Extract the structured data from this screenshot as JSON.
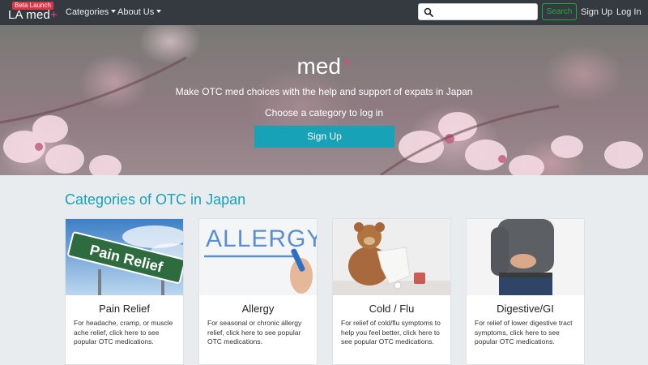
{
  "navbar": {
    "beta_badge": "Beta Launch",
    "brand": "LA med",
    "brand_plus": "+",
    "categories_label": "Categories",
    "about_label": "About Us",
    "search_placeholder": "",
    "search_button": "Search",
    "signup_link": "Sign Up",
    "login_link": "Log In"
  },
  "hero": {
    "title": "med",
    "title_plus": "+",
    "subtitle": "Make OTC med choices with the help and support of expats in Japan",
    "category_prompt": "Choose a category to log in",
    "signup_button": "Sign Up"
  },
  "section": {
    "title": "Categories of OTC in Japan"
  },
  "cards": [
    {
      "title": "Pain Relief",
      "text": "For headache, cramp, or muscle ache relief, click here to see popular OTC medications.",
      "sign_text": "Pain Relief"
    },
    {
      "title": "Allergy",
      "text": "For seasonal or chronic allergy relief, click here to see popular OTC medications.",
      "sign_text": "ALLERGY"
    },
    {
      "title": "Cold / Flu",
      "text": "For relief of cold/flu symptoms to help you feel better, click here to see popular OTC medications."
    },
    {
      "title": "Digestive/GI",
      "text": "For relief of lower digestive tract symptoms, click here to see popular OTC medications."
    }
  ],
  "colors": {
    "navbar": "#343a40",
    "accent": "#17a2b8",
    "brand_plus": "#e83e8c",
    "search_button": "#28a745",
    "beta": "#dc3545"
  }
}
